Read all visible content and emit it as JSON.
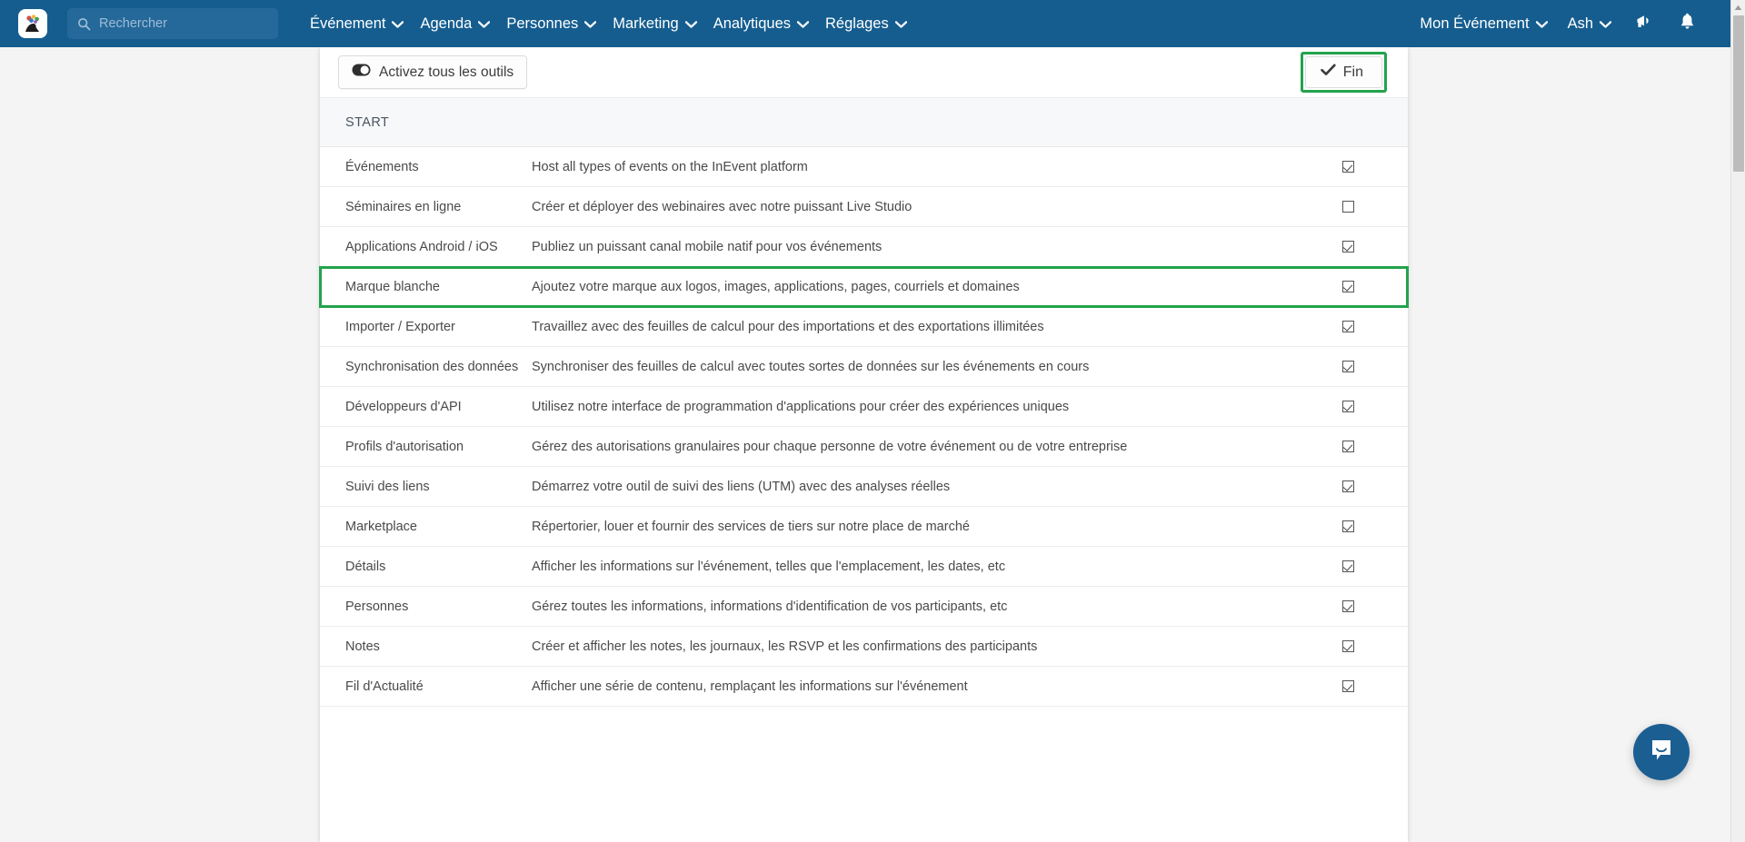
{
  "colors": {
    "navbar_bg": "#155d8f",
    "highlight_green": "#22a34c",
    "card_bg": "#ffffff",
    "section_header_bg": "#f7f8fa",
    "intercom_blue": "#1b5f92"
  },
  "topnav": {
    "logo_name": "inevent-logo",
    "search": {
      "placeholder": "Rechercher",
      "value": "",
      "icon": "search-icon"
    },
    "menu": [
      {
        "label": "Événement",
        "icon": "chevron-down-icon"
      },
      {
        "label": "Agenda",
        "icon": "chevron-down-icon"
      },
      {
        "label": "Personnes",
        "icon": "chevron-down-icon"
      },
      {
        "label": "Marketing",
        "icon": "chevron-down-icon"
      },
      {
        "label": "Analytiques",
        "icon": "chevron-down-icon"
      },
      {
        "label": "Réglages",
        "icon": "chevron-down-icon"
      }
    ],
    "right": {
      "event_selector": {
        "label": "Mon Événement",
        "icon": "chevron-down-icon"
      },
      "user_menu": {
        "label": "Ash",
        "icon": "chevron-down-icon"
      },
      "announcements_icon": "megaphone-icon",
      "notifications_icon": "bell-icon"
    }
  },
  "toolbar": {
    "toggle_all_label": "Activez tous les outils",
    "toggle_all_icon": "toggle-on-icon",
    "done_label": "Fin",
    "done_icon": "check-icon"
  },
  "section": {
    "header": "START"
  },
  "table": {
    "rows": [
      {
        "name": "Événements",
        "description": "Host all types of events on the InEvent platform",
        "checked": true,
        "highlighted": false
      },
      {
        "name": "Séminaires en ligne",
        "description": "Créer et déployer des webinaires avec notre puissant Live Studio",
        "checked": false,
        "highlighted": false
      },
      {
        "name": "Applications Android / iOS",
        "description": "Publiez un puissant canal mobile natif pour vos événements",
        "checked": true,
        "highlighted": false
      },
      {
        "name": "Marque blanche",
        "description": "Ajoutez votre marque aux logos, images, applications, pages, courriels et domaines",
        "checked": true,
        "highlighted": true
      },
      {
        "name": "Importer / Exporter",
        "description": "Travaillez avec des feuilles de calcul pour des importations et des exportations illimitées",
        "checked": true,
        "highlighted": false
      },
      {
        "name": "Synchronisation des données",
        "description": "Synchroniser des feuilles de calcul avec toutes sortes de données sur les événements en cours",
        "checked": true,
        "highlighted": false
      },
      {
        "name": "Développeurs d'API",
        "description": "Utilisez notre interface de programmation d'applications pour créer des expériences uniques",
        "checked": true,
        "highlighted": false
      },
      {
        "name": "Profils d'autorisation",
        "description": "Gérez des autorisations granulaires pour chaque personne de votre événement ou de votre entreprise",
        "checked": true,
        "highlighted": false
      },
      {
        "name": "Suivi des liens",
        "description": "Démarrez votre outil de suivi des liens (UTM) avec des analyses réelles",
        "checked": true,
        "highlighted": false
      },
      {
        "name": "Marketplace",
        "description": "Répertorier, louer et fournir des services de tiers sur notre place de marché",
        "checked": true,
        "highlighted": false
      },
      {
        "name": "Détails",
        "description": "Afficher les informations sur l'événement, telles que l'emplacement, les dates, etc",
        "checked": true,
        "highlighted": false
      },
      {
        "name": "Personnes",
        "description": "Gérez toutes les informations, informations d'identification de vos participants, etc",
        "checked": true,
        "highlighted": false
      },
      {
        "name": "Notes",
        "description": "Créer et afficher les notes, les journaux, les RSVP et les confirmations des participants",
        "checked": true,
        "highlighted": false
      },
      {
        "name": "Fil d'Actualité",
        "description": "Afficher une série de contenu, remplaçant les informations sur l'événement",
        "checked": true,
        "highlighted": false
      }
    ]
  },
  "intercom": {
    "icon": "chat-bubble-icon"
  }
}
